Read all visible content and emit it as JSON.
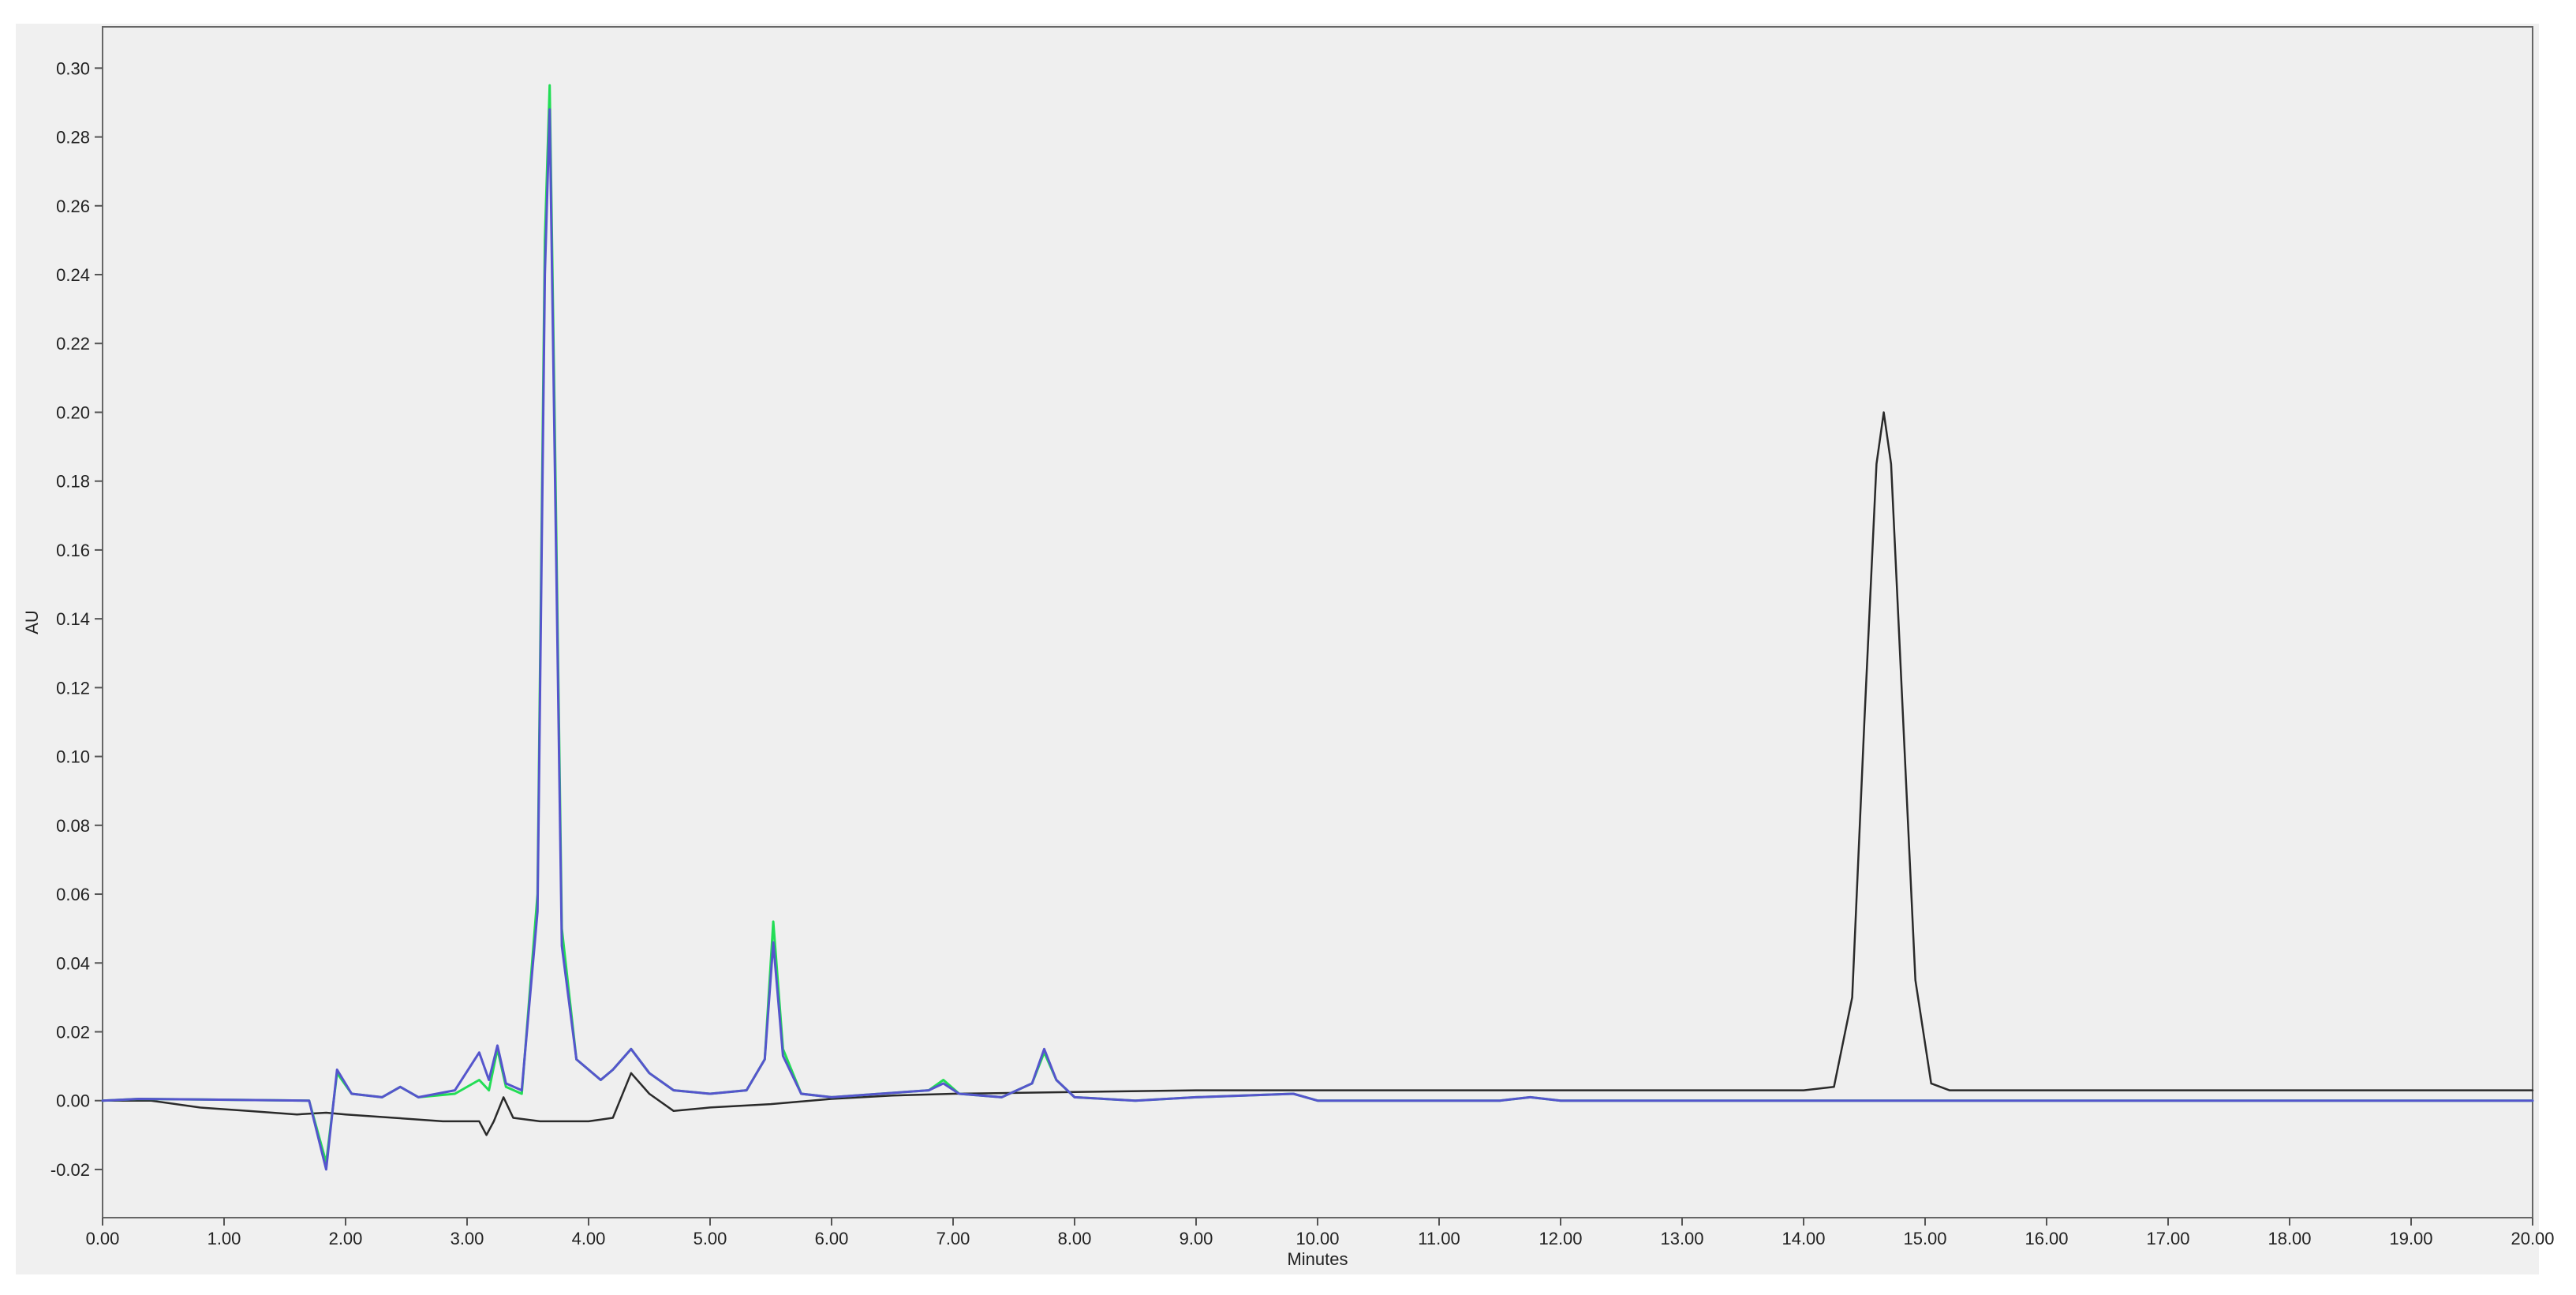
{
  "chart_data": {
    "type": "line",
    "title": "",
    "xlabel": "Minutes",
    "ylabel": "AU",
    "xlim": [
      0,
      20
    ],
    "ylim": [
      -0.034,
      0.312
    ],
    "x_ticks": [
      "0.00",
      "1.00",
      "2.00",
      "3.00",
      "4.00",
      "5.00",
      "6.00",
      "7.00",
      "8.00",
      "9.00",
      "10.00",
      "11.00",
      "12.00",
      "13.00",
      "14.00",
      "15.00",
      "16.00",
      "17.00",
      "18.00",
      "19.00",
      "20.00"
    ],
    "y_ticks": [
      "-0.02",
      "0.00",
      "0.02",
      "0.04",
      "0.06",
      "0.08",
      "0.10",
      "0.12",
      "0.14",
      "0.16",
      "0.18",
      "0.20",
      "0.22",
      "0.24",
      "0.26",
      "0.28",
      "0.30"
    ],
    "grid": false,
    "legend": "none",
    "series": [
      {
        "color": "#2a2a2a",
        "points": [
          [
            0,
            0
          ],
          [
            0.4,
            0
          ],
          [
            0.8,
            -0.002
          ],
          [
            1.2,
            -0.003
          ],
          [
            1.6,
            -0.004
          ],
          [
            1.84,
            -0.0035
          ],
          [
            2.0,
            -0.004
          ],
          [
            2.4,
            -0.005
          ],
          [
            2.8,
            -0.006
          ],
          [
            3.1,
            -0.006
          ],
          [
            3.16,
            -0.01
          ],
          [
            3.22,
            -0.006
          ],
          [
            3.3,
            0.001
          ],
          [
            3.38,
            -0.005
          ],
          [
            3.6,
            -0.006
          ],
          [
            4.0,
            -0.006
          ],
          [
            4.2,
            -0.005
          ],
          [
            4.35,
            0.008
          ],
          [
            4.5,
            0.002
          ],
          [
            4.7,
            -0.003
          ],
          [
            5.0,
            -0.002
          ],
          [
            5.5,
            -0.001
          ],
          [
            6.0,
            0.0005
          ],
          [
            6.5,
            0.0015
          ],
          [
            7.0,
            0.002
          ],
          [
            8.0,
            0.0025
          ],
          [
            9.0,
            0.003
          ],
          [
            10.0,
            0.003
          ],
          [
            12.0,
            0.003
          ],
          [
            14.0,
            0.003
          ],
          [
            14.25,
            0.004
          ],
          [
            14.4,
            0.03
          ],
          [
            14.5,
            0.11
          ],
          [
            14.6,
            0.185
          ],
          [
            14.66,
            0.2
          ],
          [
            14.72,
            0.185
          ],
          [
            14.82,
            0.11
          ],
          [
            14.92,
            0.035
          ],
          [
            15.05,
            0.005
          ],
          [
            15.2,
            0.003
          ],
          [
            16.0,
            0.003
          ],
          [
            18.0,
            0.003
          ],
          [
            20.0,
            0.003
          ]
        ]
      },
      {
        "color": "#22dd55",
        "points": [
          [
            0,
            0
          ],
          [
            0.3,
            0.0005
          ],
          [
            1.7,
            0
          ],
          [
            1.84,
            -0.018
          ],
          [
            1.93,
            0.008
          ],
          [
            2.05,
            0.002
          ],
          [
            2.3,
            0.001
          ],
          [
            2.45,
            0.004
          ],
          [
            2.6,
            0.001
          ],
          [
            2.9,
            0.002
          ],
          [
            3.1,
            0.006
          ],
          [
            3.18,
            0.003
          ],
          [
            3.25,
            0.015
          ],
          [
            3.32,
            0.004
          ],
          [
            3.45,
            0.002
          ],
          [
            3.58,
            0.06
          ],
          [
            3.64,
            0.25
          ],
          [
            3.68,
            0.295
          ],
          [
            3.72,
            0.2
          ],
          [
            3.78,
            0.05
          ],
          [
            3.9,
            0.012
          ],
          [
            4.1,
            0.006
          ],
          [
            4.2,
            0.009
          ],
          [
            4.35,
            0.015
          ],
          [
            4.5,
            0.008
          ],
          [
            4.7,
            0.003
          ],
          [
            5.0,
            0.002
          ],
          [
            5.3,
            0.003
          ],
          [
            5.45,
            0.012
          ],
          [
            5.52,
            0.052
          ],
          [
            5.6,
            0.015
          ],
          [
            5.75,
            0.002
          ],
          [
            6.0,
            0.001
          ],
          [
            6.4,
            0.002
          ],
          [
            6.8,
            0.003
          ],
          [
            6.92,
            0.006
          ],
          [
            7.05,
            0.002
          ],
          [
            7.4,
            0.001
          ],
          [
            7.65,
            0.005
          ],
          [
            7.75,
            0.014
          ],
          [
            7.85,
            0.006
          ],
          [
            8.0,
            0.001
          ],
          [
            8.5,
            0
          ],
          [
            9.0,
            0.001
          ],
          [
            9.8,
            0.002
          ],
          [
            10.0,
            0
          ],
          [
            11.5,
            0
          ],
          [
            11.75,
            0.001
          ],
          [
            12.0,
            0
          ],
          [
            14.0,
            0
          ],
          [
            16.5,
            0
          ],
          [
            20.0,
            0
          ]
        ]
      },
      {
        "color": "#5555cc",
        "points": [
          [
            0,
            0
          ],
          [
            0.3,
            0.0005
          ],
          [
            1.7,
            0
          ],
          [
            1.84,
            -0.02
          ],
          [
            1.93,
            0.009
          ],
          [
            2.05,
            0.002
          ],
          [
            2.3,
            0.001
          ],
          [
            2.45,
            0.004
          ],
          [
            2.6,
            0.001
          ],
          [
            2.9,
            0.003
          ],
          [
            3.1,
            0.014
          ],
          [
            3.18,
            0.006
          ],
          [
            3.25,
            0.016
          ],
          [
            3.32,
            0.005
          ],
          [
            3.45,
            0.003
          ],
          [
            3.58,
            0.055
          ],
          [
            3.64,
            0.24
          ],
          [
            3.68,
            0.288
          ],
          [
            3.72,
            0.19
          ],
          [
            3.78,
            0.045
          ],
          [
            3.9,
            0.012
          ],
          [
            4.1,
            0.006
          ],
          [
            4.2,
            0.009
          ],
          [
            4.35,
            0.015
          ],
          [
            4.5,
            0.008
          ],
          [
            4.7,
            0.003
          ],
          [
            5.0,
            0.002
          ],
          [
            5.3,
            0.003
          ],
          [
            5.45,
            0.012
          ],
          [
            5.52,
            0.046
          ],
          [
            5.6,
            0.013
          ],
          [
            5.75,
            0.002
          ],
          [
            6.0,
            0.001
          ],
          [
            6.4,
            0.002
          ],
          [
            6.8,
            0.003
          ],
          [
            6.92,
            0.005
          ],
          [
            7.05,
            0.002
          ],
          [
            7.4,
            0.001
          ],
          [
            7.65,
            0.005
          ],
          [
            7.75,
            0.015
          ],
          [
            7.85,
            0.006
          ],
          [
            8.0,
            0.001
          ],
          [
            8.5,
            0
          ],
          [
            9.0,
            0.001
          ],
          [
            9.8,
            0.002
          ],
          [
            10.0,
            0
          ],
          [
            11.5,
            0
          ],
          [
            11.75,
            0.001
          ],
          [
            12.0,
            0
          ],
          [
            14.0,
            0
          ],
          [
            16.5,
            0
          ],
          [
            20.0,
            0
          ]
        ]
      }
    ]
  }
}
